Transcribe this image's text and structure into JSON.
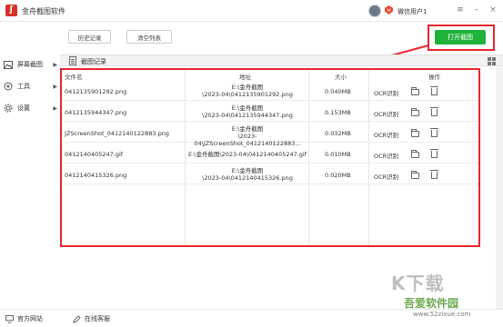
{
  "titlebar": {
    "app_title": "金舟截图软件",
    "username": "微信用户1"
  },
  "sidebar": {
    "items": [
      {
        "label": "屏幕截图",
        "icon": "image-icon"
      },
      {
        "label": "工具",
        "icon": "tools-icon"
      },
      {
        "label": "设置",
        "icon": "gear-icon"
      }
    ]
  },
  "toolbar": {
    "history_label": "历史记录",
    "clear_label": "清空列表",
    "open_label": "打开截图"
  },
  "section": {
    "title": "截图记录"
  },
  "table": {
    "headers": [
      "文件名",
      "地址",
      "大小",
      "操作"
    ],
    "ocr_label": "OCR识别",
    "rows": [
      {
        "name": "0412135901292.png",
        "addr1": "E:\\金舟截图",
        "addr2": "\\2023-04\\0412135901292.png",
        "size": "0.040MB"
      },
      {
        "name": "0412135944347.png",
        "addr1": "E:\\金舟截图",
        "addr2": "\\2023-04\\0412135944347.png",
        "size": "0.153MB"
      },
      {
        "name": "JZScreenShot_0412140122883.png",
        "addr1": "E:\\金舟截图",
        "addr2": "\\2023-04\\JZScreenShot_0412140122883...",
        "size": "0.032MB"
      },
      {
        "name": "0412140405247.gif",
        "addr1": "E:\\金舟截图\\2023-04\\0412140405247.gif",
        "addr2": "",
        "size": "0.010MB"
      },
      {
        "name": "0412140415326.png",
        "addr1": "E:\\金舟截图",
        "addr2": "\\2023-04\\0412140415326.png",
        "size": "0.020MB"
      }
    ]
  },
  "footer": {
    "website_label": "官方网站",
    "support_label": "在线客服"
  },
  "watermark": {
    "big": "K下载",
    "brand": "吾爱软件园",
    "url": "www.52zixue.com"
  },
  "colors": {
    "accent_green": "#1fb23a",
    "highlight_red": "#e8262d"
  }
}
